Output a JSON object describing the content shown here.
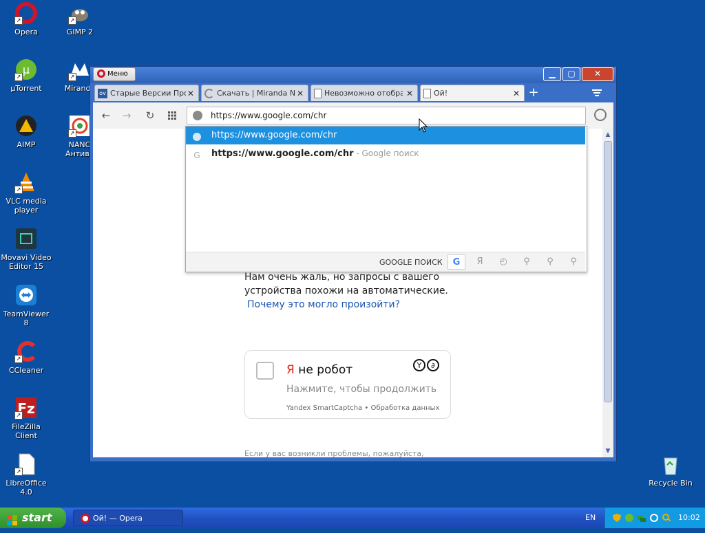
{
  "desktop": {
    "icons": [
      {
        "label": "Opera"
      },
      {
        "label": "GIMP 2"
      },
      {
        "label": "µTorrent"
      },
      {
        "label": "Miranda"
      },
      {
        "label": "AIMP"
      },
      {
        "label": "NANO\nАнтиви"
      },
      {
        "label": "VLC media\nplayer"
      },
      {
        "label": "Movavi Video\nEditor 15"
      },
      {
        "label": "TeamViewer 8"
      },
      {
        "label": "CCleaner"
      },
      {
        "label": "FileZilla Client"
      },
      {
        "label": "LibreOffice 4.0"
      },
      {
        "label": "Recycle Bin"
      }
    ]
  },
  "window": {
    "menu_label": "Меню",
    "buttons": {
      "minimize": "▁",
      "maximize": "▢",
      "close": "✕"
    },
    "tabs": [
      {
        "title": "Старые Версии Прог",
        "favicon": "ov-icon"
      },
      {
        "title": "Скачать | Miranda N",
        "favicon": "loading-icon"
      },
      {
        "title": "Невозможно отобра",
        "favicon": "page-icon"
      },
      {
        "title": "Ой!",
        "favicon": "page-icon",
        "active": true
      }
    ],
    "new_tab": "+",
    "address": {
      "value": "https://www.google.com/chr"
    },
    "suggestions": [
      {
        "url": "https://www.google.com/chr",
        "suffix": ""
      },
      {
        "url": "https://www.google.com/chr",
        "suffix": " - Google поиск"
      }
    ],
    "search_label": "GOOGLE ПОИСК",
    "page": {
      "message_line1": "Нам очень жаль, но запросы с вашего",
      "message_line2": "устройства похожи на автоматические.",
      "link": "Почему это могло произойти?",
      "captcha": {
        "title_red": "Я",
        "title_rest": " не робот",
        "hint": "Нажмите, чтобы продолжить",
        "footer": "Yandex SmartCaptcha • Обработка данных"
      },
      "footer_text": "Если у вас возникли проблемы, пожалуйста,"
    }
  },
  "taskbar": {
    "start": "start",
    "task_label": "Ой! — Opera",
    "lang": "EN",
    "clock": "10:02"
  }
}
